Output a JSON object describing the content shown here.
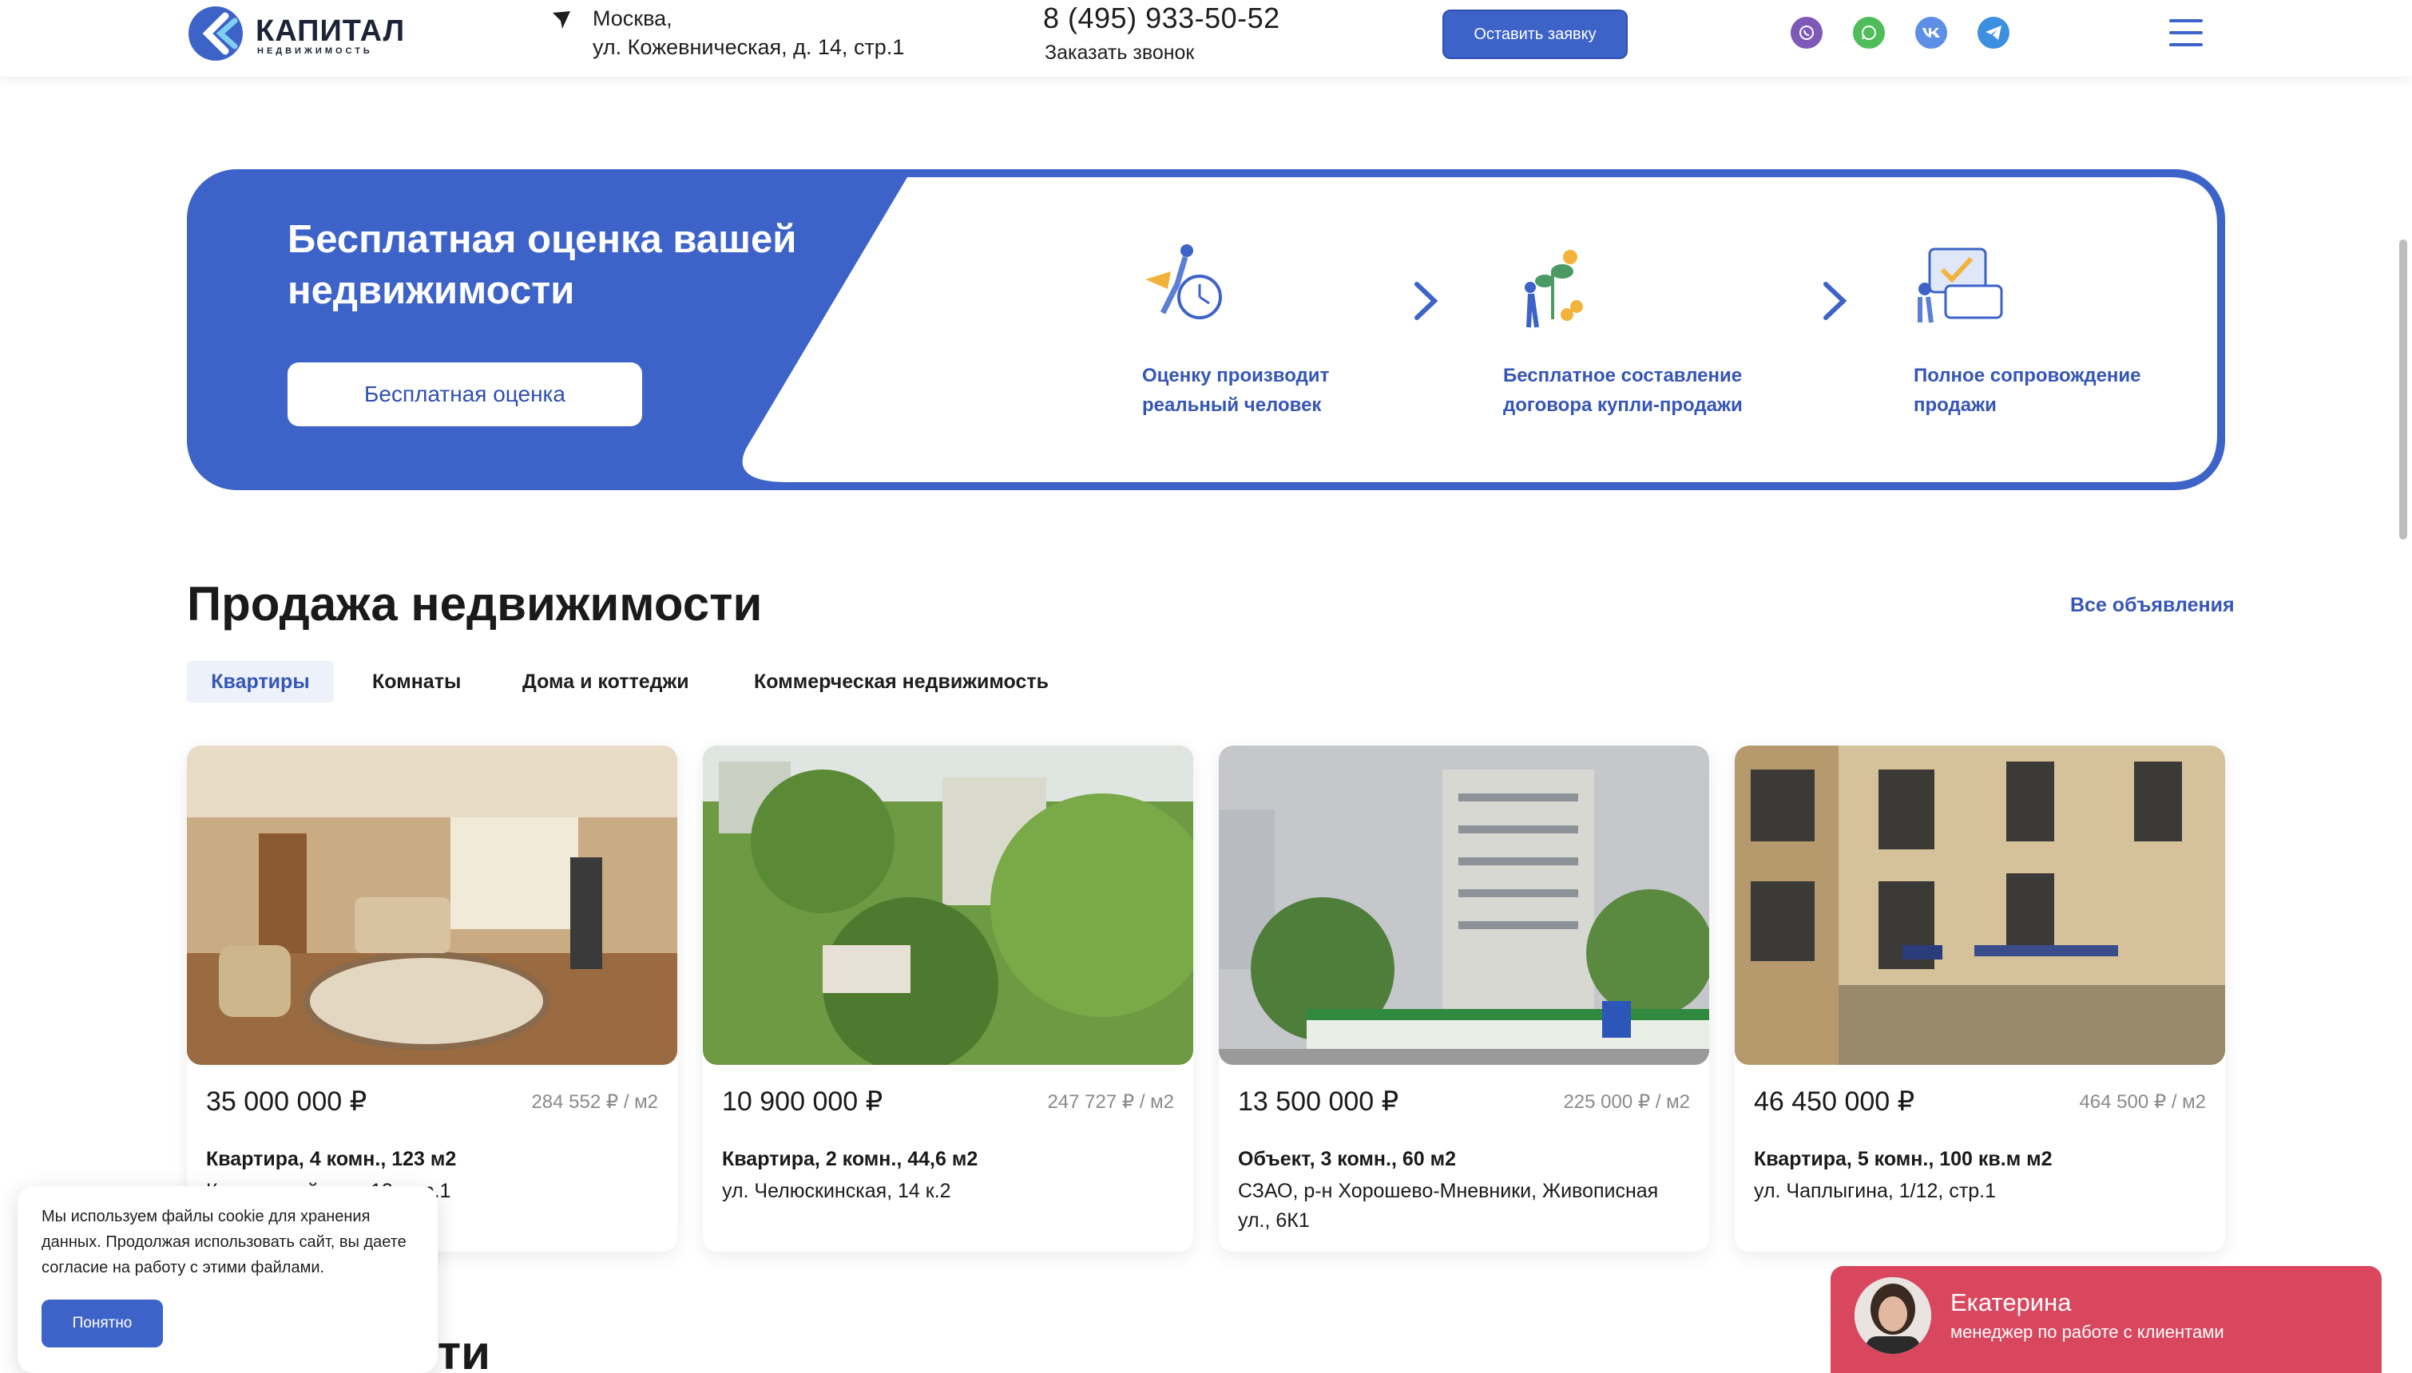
{
  "header": {
    "logo": {
      "name": "КАПИТАЛ",
      "sub": "НЕДВИЖИМОСТЬ"
    },
    "address": {
      "line1": "Москва,",
      "line2": "ул. Кожевническая, д. 14, стр.1"
    },
    "phone": "8 (495) 933-50-52",
    "callback_label": "Заказать звонок",
    "request_button": "Оставить заявку",
    "socials": [
      {
        "icon": "viber-icon",
        "color": "#7d5ab8"
      },
      {
        "icon": "whatsapp-icon",
        "color": "#4fbd5b"
      },
      {
        "icon": "vk-icon",
        "color": "#5d8fe6"
      },
      {
        "icon": "telegram-icon",
        "color": "#3d8fe0"
      }
    ],
    "menu_icon": "hamburger-menu-icon"
  },
  "banner": {
    "title": "Бесплатная оценка вашей недвижимости",
    "button": "Бесплатная оценка",
    "features": [
      {
        "label_line1": "Оценку производит",
        "label_line2": "реальный человек",
        "icon": "person-valuation-icon"
      },
      {
        "label_line1": "Бесплатное составление",
        "label_line2": "договора купли-продажи",
        "icon": "contract-plant-icon"
      },
      {
        "label_line1": "Полное сопровождение",
        "label_line2": "продажи",
        "icon": "documents-support-icon"
      }
    ],
    "accent_color": "#3d63c9"
  },
  "sales": {
    "title": "Продажа недвижимости",
    "all_link": "Все объявления",
    "tabs": [
      "Квартиры",
      "Комнаты",
      "Дома и коттеджи",
      "Коммерческая недвижимость"
    ],
    "active_tab": "Квартиры",
    "cards": [
      {
        "price": "35 000 000 ₽",
        "price_per_m2": "284 552 ₽ / м2",
        "title": "Квартира, 4 комн., 123 м2",
        "address": "Кутузовский пр-т, 12, стр.1"
      },
      {
        "price": "10 900 000 ₽",
        "price_per_m2": "247 727 ₽ / м2",
        "title": "Квартира, 2 комн., 44,6 м2",
        "address": "ул. Челюскинская, 14 к.2"
      },
      {
        "price": "13 500 000 ₽",
        "price_per_m2": "225 000 ₽ / м2",
        "title": "Объект, 3 комн., 60 м2",
        "address": "СЗАО, р-н Хорошево-Мневники, Живописная ул., 6К1"
      },
      {
        "price": "46 450 000 ₽",
        "price_per_m2": "464 500 ₽ / м2",
        "title": "Квартира, 5 комн., 100 кв.м м2",
        "address": "ул. Чаплыгина, 1/12, стр.1"
      }
    ]
  },
  "cookie": {
    "text": "Мы используем файлы cookie для хранения данных. Продолжая использовать сайт, вы даете согласие на работу с этими файлами.",
    "button": "Понятно"
  },
  "next_section": {
    "title_partial": "ти"
  },
  "chat": {
    "name": "Екатерина",
    "role": "менеджер по работе с клиентами",
    "color": "#d9475e"
  }
}
